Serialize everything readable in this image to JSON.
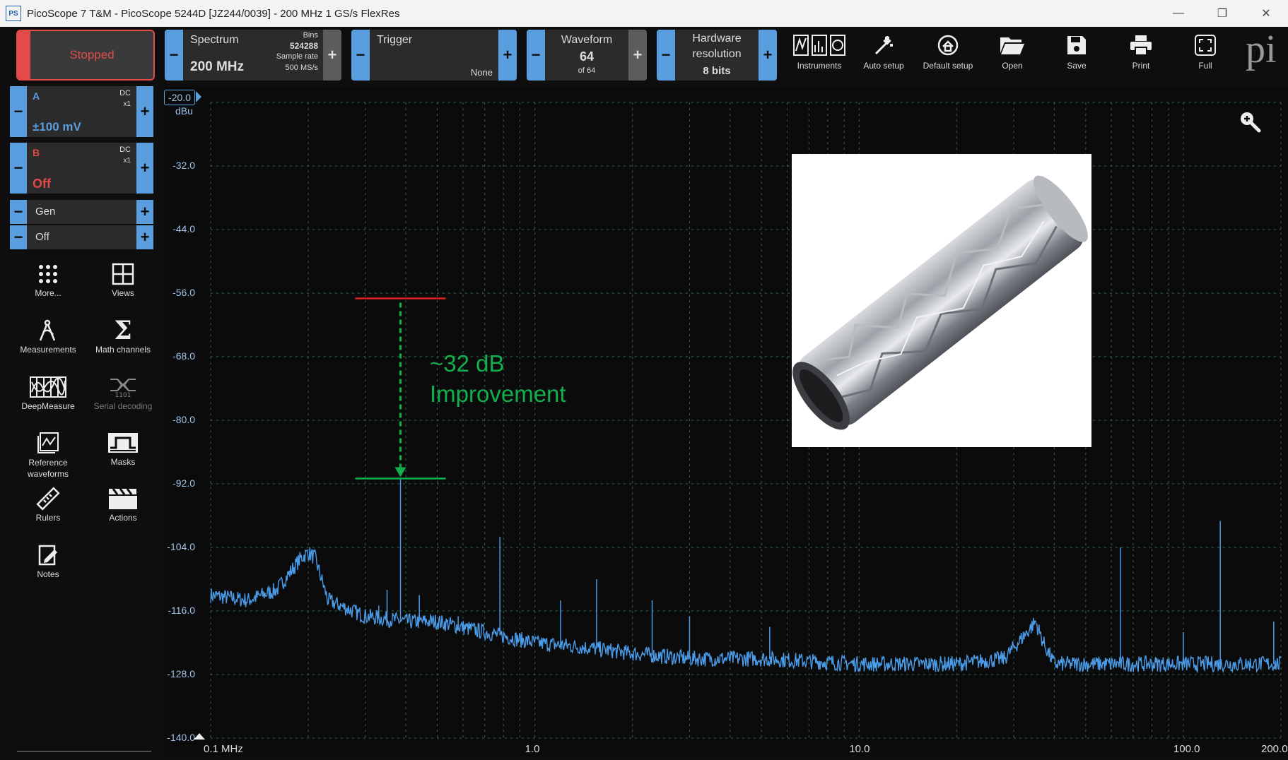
{
  "window": {
    "app_icon": "PS",
    "title": "PicoScope 7 T&M  - PicoScope 5244D [JZ244/0039] - 200 MHz 1 GS/s FlexRes",
    "minimize": "—",
    "maximize": "❐",
    "close": "✕"
  },
  "toolbar": {
    "run_state": "Stopped",
    "spectrum": {
      "label": "Spectrum",
      "value": "200 MHz",
      "bins_label": "Bins",
      "bins_value": "524288",
      "rate_label": "Sample rate",
      "rate_value": "500 MS/s"
    },
    "trigger": {
      "label": "Trigger",
      "value": "None"
    },
    "waveform": {
      "label": "Waveform",
      "value": "64",
      "of": "of 64"
    },
    "hardware": {
      "label1": "Hardware",
      "label2": "resolution",
      "value": "8 bits"
    },
    "buttons": [
      {
        "label": "Instruments",
        "icon": "instruments-icon"
      },
      {
        "label": "Auto setup",
        "icon": "auto-setup-icon"
      },
      {
        "label": "Default setup",
        "icon": "default-setup-icon"
      },
      {
        "label": "Open",
        "icon": "folder-open-icon"
      },
      {
        "label": "Save",
        "icon": "save-icon"
      },
      {
        "label": "Print",
        "icon": "printer-icon"
      },
      {
        "label": "Full",
        "icon": "fullscreen-icon"
      }
    ],
    "logo_text": "pi"
  },
  "channels": {
    "a": {
      "name": "A",
      "coupling": "DC",
      "probe": "x1",
      "range": "±100 mV",
      "color": "#5b9ee0"
    },
    "b": {
      "name": "B",
      "coupling": "DC",
      "probe": "x1",
      "range": "Off",
      "color": "#e34a4a"
    },
    "gen": {
      "label": "Gen",
      "state": "Off"
    }
  },
  "sidebar": {
    "items": [
      {
        "label": "More...",
        "icon": "more-grid-icon"
      },
      {
        "label": "Views",
        "icon": "views-icon"
      },
      {
        "label": "Measurements",
        "icon": "measurements-icon"
      },
      {
        "label": "Math channels",
        "icon": "sigma-icon"
      },
      {
        "label": "DeepMeasure",
        "icon": "deepmeasure-icon"
      },
      {
        "label": "Serial decoding",
        "icon": "serial-decoding-icon"
      },
      {
        "label": "Reference waveforms",
        "icon": "reference-waveform-icon"
      },
      {
        "label": "Masks",
        "icon": "masks-icon"
      },
      {
        "label": "Rulers",
        "icon": "ruler-icon"
      },
      {
        "label": "Actions",
        "icon": "clapperboard-icon"
      },
      {
        "label": "Notes",
        "icon": "notes-icon"
      }
    ]
  },
  "plot": {
    "y_unit": "dBu",
    "annotation_line1": "~32 dB",
    "annotation_line2": "Improvement",
    "zoom_icon": "zoom-in-icon",
    "colors": {
      "trace": "#4a9be8",
      "grid": "#2f6b4f",
      "upper_marker": "#e02020",
      "lower_marker": "#12b04c"
    }
  },
  "chart_data": {
    "type": "line",
    "x_scale": "log",
    "xlim": [
      0.1,
      200
    ],
    "ylim": [
      -140,
      -20
    ],
    "ylabel": "dBu",
    "y_ticks": [
      "-20.0",
      "-32.0",
      "-44.0",
      "-56.0",
      "-68.0",
      "-80.0",
      "-92.0",
      "-104.0",
      "-116.0",
      "-128.0",
      "-140.0"
    ],
    "x_ticks": [
      {
        "value": 0.1,
        "label": "0.1 MHz"
      },
      {
        "value": 1,
        "label": "1.0"
      },
      {
        "value": 10,
        "label": "10.0"
      },
      {
        "value": 100,
        "label": "100.0"
      },
      {
        "value": 200,
        "label": "200.0"
      }
    ],
    "noise_floor": [
      [
        0.1,
        -113
      ],
      [
        0.13,
        -114
      ],
      [
        0.16,
        -112
      ],
      [
        0.19,
        -106
      ],
      [
        0.2,
        -105
      ],
      [
        0.21,
        -106
      ],
      [
        0.23,
        -114
      ],
      [
        0.3,
        -117
      ],
      [
        0.4,
        -118
      ],
      [
        0.5,
        -118
      ],
      [
        0.7,
        -120
      ],
      [
        1.0,
        -122
      ],
      [
        1.5,
        -123
      ],
      [
        2,
        -124
      ],
      [
        3,
        -125
      ],
      [
        5,
        -125
      ],
      [
        10,
        -126
      ],
      [
        20,
        -126
      ],
      [
        28,
        -125
      ],
      [
        33,
        -120
      ],
      [
        35,
        -118
      ],
      [
        37,
        -122
      ],
      [
        40,
        -126
      ],
      [
        60,
        -126
      ],
      [
        100,
        -126
      ],
      [
        200,
        -126
      ]
    ],
    "spikes": [
      [
        0.385,
        -91
      ],
      [
        0.35,
        -112
      ],
      [
        0.33,
        -115
      ],
      [
        0.44,
        -113
      ],
      [
        0.58,
        -117
      ],
      [
        0.78,
        -102
      ],
      [
        1.2,
        -114
      ],
      [
        1.55,
        -110
      ],
      [
        2.3,
        -114
      ],
      [
        3.0,
        -117
      ],
      [
        5.3,
        -119
      ],
      [
        64,
        -104
      ],
      [
        100,
        -120
      ],
      [
        130,
        -99
      ],
      [
        190,
        -118
      ]
    ],
    "markers": {
      "upper_db": -57,
      "lower_db": -91
    }
  }
}
